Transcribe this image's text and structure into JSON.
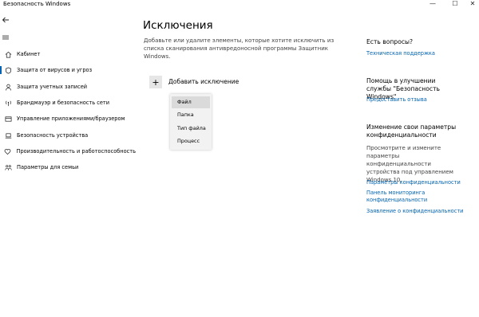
{
  "window": {
    "title": "Безопасность Windows",
    "minimize_glyph": "—",
    "maximize_glyph": "☐",
    "close_glyph": "✕"
  },
  "nav": {
    "back_icon": "back-arrow-icon",
    "menu_icon": "hamburger-icon",
    "items": [
      {
        "label": "Кабинет",
        "icon": "home-icon"
      },
      {
        "label": "Защита от вирусов и угроз",
        "icon": "shield-icon"
      },
      {
        "label": "Защита учетных записей",
        "icon": "person-icon"
      },
      {
        "label": "Брандмауэр и безопасность сети",
        "icon": "antenna-icon"
      },
      {
        "label": "Управление приложениями/браузером",
        "icon": "app-window-icon"
      },
      {
        "label": "Безопасность устройства",
        "icon": "laptop-icon"
      },
      {
        "label": "Производительность и работоспособность",
        "icon": "heart-icon"
      },
      {
        "label": "Параметры для семьи",
        "icon": "family-icon"
      }
    ]
  },
  "main": {
    "title": "Исключения",
    "description": "Добавьте или удалите элементы, которые хотите исключить из списка сканирования антивредоносной программы Защитник Windows.",
    "add_button_glyph": "+",
    "add_label": "Добавить исключение",
    "menu_items": [
      "Файл",
      "Папка",
      "Тип файла",
      "Процесс"
    ]
  },
  "right": {
    "questions_heading": "Есть вопросы?",
    "support_link": "Техническая поддержка",
    "improve_heading": "Помощь в улучшении службы \"Безопасность Windows\"",
    "feedback_link": "Предоставить отзыва",
    "privacy_heading": "Изменение свои параметры конфиденциальности",
    "privacy_text": "Просмотрите и измените параметры конфиденциальности устройства под управлением Windows 10.",
    "privacy_links": [
      "Параметры конфиденциальности",
      "Панель мониторинга конфиденциальности",
      "Заявление о конфиденциальности"
    ]
  },
  "colors": {
    "accent": "#0063b1",
    "menu_bg": "#f2f2f2",
    "selected": "#dadada"
  }
}
